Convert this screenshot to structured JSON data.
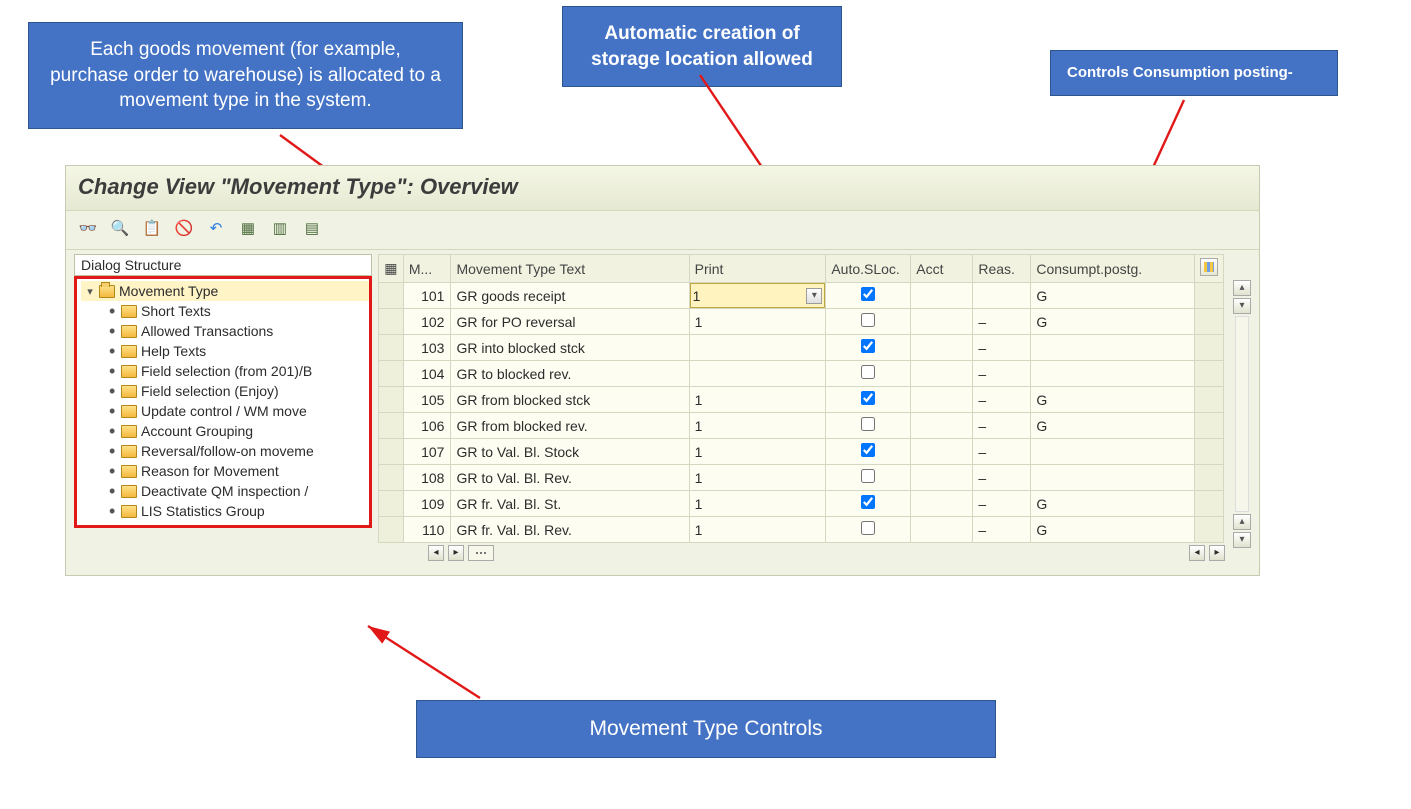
{
  "callouts": {
    "movement_desc": "Each goods movement (for example, purchase order to warehouse) is allocated to a movement type in the system.",
    "auto_sloc": "Automatic creation of storage location allowed",
    "consumption": "Controls Consumption posting-",
    "controls": "Movement Type Controls"
  },
  "sap": {
    "title": "Change View \"Movement Type\": Overview",
    "toolbar_icons": [
      "glasses-icon",
      "find-icon",
      "copy-icon",
      "delete-row-icon",
      "undo-icon",
      "select-all-icon",
      "insert-row-icon",
      "append-row-icon"
    ],
    "tree": {
      "header": "Dialog Structure",
      "root": "Movement Type",
      "children": [
        "Short Texts",
        "Allowed Transactions",
        "Help Texts",
        "Field selection (from 201)/B",
        "Field selection (Enjoy)",
        "Update control / WM move",
        "Account Grouping",
        "Reversal/follow-on moveme",
        "Reason for Movement",
        "Deactivate QM inspection /",
        "LIS Statistics Group"
      ]
    },
    "grid": {
      "columns": {
        "sel": "",
        "code": "M...",
        "text": "Movement Type Text",
        "print": "Print",
        "asloc": "Auto.SLoc.",
        "acct": "Acct",
        "reas": "Reas.",
        "cons": "Consumpt.postg."
      },
      "rows": [
        {
          "code": "101",
          "text": "GR goods receipt",
          "print": "1",
          "print_selected": true,
          "asloc": true,
          "acct": "",
          "reas": "",
          "cons": "G"
        },
        {
          "code": "102",
          "text": "GR for PO   reversal",
          "print": "1",
          "asloc": false,
          "acct": "",
          "reas": "–",
          "cons": "G"
        },
        {
          "code": "103",
          "text": "GR into blocked stck",
          "print": "",
          "asloc": true,
          "acct": "",
          "reas": "–",
          "cons": ""
        },
        {
          "code": "104",
          "text": "GR to blocked rev.",
          "print": "",
          "asloc": false,
          "acct": "",
          "reas": "–",
          "cons": ""
        },
        {
          "code": "105",
          "text": "GR from blocked stck",
          "print": "1",
          "asloc": true,
          "acct": "",
          "reas": "–",
          "cons": "G"
        },
        {
          "code": "106",
          "text": "GR from blocked rev.",
          "print": "1",
          "asloc": false,
          "acct": "",
          "reas": "–",
          "cons": "G"
        },
        {
          "code": "107",
          "text": "GR to Val. Bl. Stock",
          "print": "1",
          "asloc": true,
          "acct": "",
          "reas": "–",
          "cons": ""
        },
        {
          "code": "108",
          "text": "GR to Val. Bl. Rev.",
          "print": "1",
          "asloc": false,
          "acct": "",
          "reas": "–",
          "cons": ""
        },
        {
          "code": "109",
          "text": "GR fr. Val. Bl. St.",
          "print": "1",
          "asloc": true,
          "acct": "",
          "reas": "–",
          "cons": "G"
        },
        {
          "code": "110",
          "text": "GR fr. Val. Bl. Rev.",
          "print": "1",
          "asloc": false,
          "acct": "",
          "reas": "–",
          "cons": "G"
        }
      ]
    }
  }
}
